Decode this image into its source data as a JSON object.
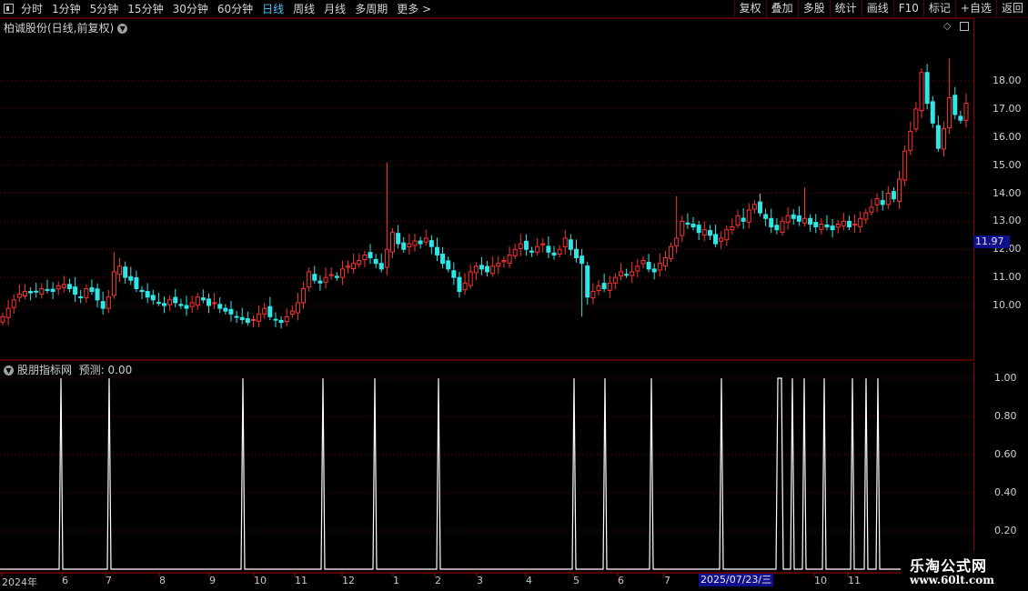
{
  "toolbar": {
    "periods": [
      "分时",
      "1分钟",
      "5分钟",
      "15分钟",
      "30分钟",
      "60分钟",
      "日线",
      "周线",
      "月线",
      "多周期",
      "更多 >"
    ],
    "active_period": "日线",
    "buttons": [
      "复权",
      "叠加",
      "多股",
      "统计",
      "画线",
      "F10",
      "标记",
      "+自选",
      "返回"
    ]
  },
  "main_chart": {
    "title": "柏诚股份(日线,前复权)",
    "current_price": "11.97",
    "price_labels": [
      "18.00",
      "17.00",
      "16.00",
      "15.00",
      "14.00",
      "13.00",
      "12.00",
      "11.00",
      "10.00"
    ],
    "price_range": [
      9.0,
      19.0
    ],
    "up_color": "#ff3333",
    "down_color": "#2ee6e6"
  },
  "indicator": {
    "title": "股朋指标网",
    "prediction": "预测: 0.00",
    "axis_labels": [
      "1.00",
      "0.80",
      "0.60",
      "0.40",
      "0.20"
    ],
    "signal_color": "#ffffff"
  },
  "x_axis": {
    "labels": [
      "2024年",
      "6",
      "7",
      "8",
      "9",
      "10",
      "11",
      "12",
      "1",
      "2",
      "3",
      "4",
      "5",
      "6",
      "7",
      "10",
      "11"
    ],
    "cursor_date": "2025/07/23/三"
  },
  "watermark": {
    "title": "乐淘公式网",
    "url": "www.60lt.com"
  },
  "chart_data": {
    "type": "candlestick",
    "description_series": "daily close, front-adjusted",
    "close": [
      9.6,
      9.9,
      10.2,
      10.4,
      10.5,
      10.45,
      10.5,
      10.6,
      10.55,
      10.5,
      10.7,
      10.75,
      10.6,
      10.4,
      10.3,
      10.6,
      10.5,
      10.2,
      9.9,
      10.3,
      11.2,
      11.4,
      11.0,
      10.9,
      10.6,
      10.5,
      10.3,
      10.2,
      10.1,
      10.0,
      10.2,
      10.1,
      10.0,
      9.9,
      10.1,
      10.3,
      10.2,
      10.0,
      10.1,
      9.9,
      9.8,
      9.7,
      9.6,
      9.5,
      9.4,
      9.5,
      9.7,
      9.9,
      9.6,
      9.5,
      9.4,
      9.6,
      9.8,
      10.1,
      10.6,
      11.2,
      10.9,
      10.8,
      11.0,
      11.1,
      11.0,
      11.3,
      11.4,
      11.5,
      11.6,
      11.8,
      11.7,
      11.5,
      11.3,
      12.0,
      12.6,
      12.2,
      12.0,
      12.2,
      12.3,
      12.2,
      12.4,
      12.1,
      11.8,
      11.5,
      11.3,
      11.0,
      10.5,
      10.8,
      11.2,
      11.4,
      11.3,
      11.2,
      11.4,
      11.5,
      11.6,
      11.8,
      12.0,
      12.2,
      12.0,
      11.9,
      12.1,
      12.2,
      11.9,
      11.8,
      12.0,
      12.4,
      12.0,
      11.7,
      11.5,
      10.3,
      10.5,
      10.7,
      10.6,
      10.8,
      11.0,
      11.2,
      11.1,
      11.2,
      11.4,
      11.6,
      11.3,
      11.2,
      11.5,
      11.7,
      12.1,
      12.4,
      13.0,
      12.9,
      12.8,
      12.6,
      12.7,
      12.5,
      12.2,
      12.4,
      12.7,
      12.8,
      13.2,
      13.0,
      13.4,
      13.6,
      13.3,
      13.1,
      12.8,
      12.7,
      13.0,
      13.2,
      13.1,
      13.0,
      13.1,
      12.9,
      12.8,
      12.9,
      12.8,
      12.7,
      12.9,
      13.0,
      12.8,
      12.9,
      13.1,
      13.3,
      13.5,
      13.8,
      13.6,
      14.0,
      13.8,
      14.5,
      15.5,
      16.2,
      17.0,
      18.3,
      17.2,
      16.5,
      15.6,
      16.3,
      17.4,
      16.8,
      16.6,
      17.2
    ]
  }
}
